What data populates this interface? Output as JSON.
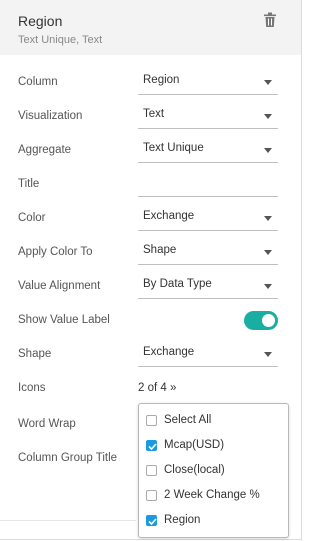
{
  "header": {
    "title": "Region",
    "subtitle": "Text Unique, Text"
  },
  "fields": {
    "column": {
      "label": "Column",
      "value": "Region"
    },
    "visualization": {
      "label": "Visualization",
      "value": "Text"
    },
    "aggregate": {
      "label": "Aggregate",
      "value": "Text Unique"
    },
    "title": {
      "label": "Title",
      "value": ""
    },
    "color": {
      "label": "Color",
      "value": "Exchange"
    },
    "apply_color_to": {
      "label": "Apply Color To",
      "value": "Shape"
    },
    "value_alignment": {
      "label": "Value Alignment",
      "value": "By Data Type"
    },
    "show_value_label": {
      "label": "Show Value Label",
      "on": true
    },
    "shape": {
      "label": "Shape",
      "value": "Exchange"
    },
    "icons": {
      "label": "Icons",
      "value": "2 of 4 »"
    },
    "word_wrap": {
      "label": "Word Wrap"
    },
    "column_group_title": {
      "label": "Column Group Title"
    }
  },
  "icons_dropdown": {
    "options": [
      {
        "label": "Select All",
        "checked": false
      },
      {
        "label": "Mcap(USD)",
        "checked": true
      },
      {
        "label": "Close(local)",
        "checked": false
      },
      {
        "label": "2 Week Change %",
        "checked": false
      },
      {
        "label": "Region",
        "checked": true
      }
    ]
  },
  "colors": {
    "accent": "#1aaea2",
    "checkbox": "#1a9be0"
  }
}
